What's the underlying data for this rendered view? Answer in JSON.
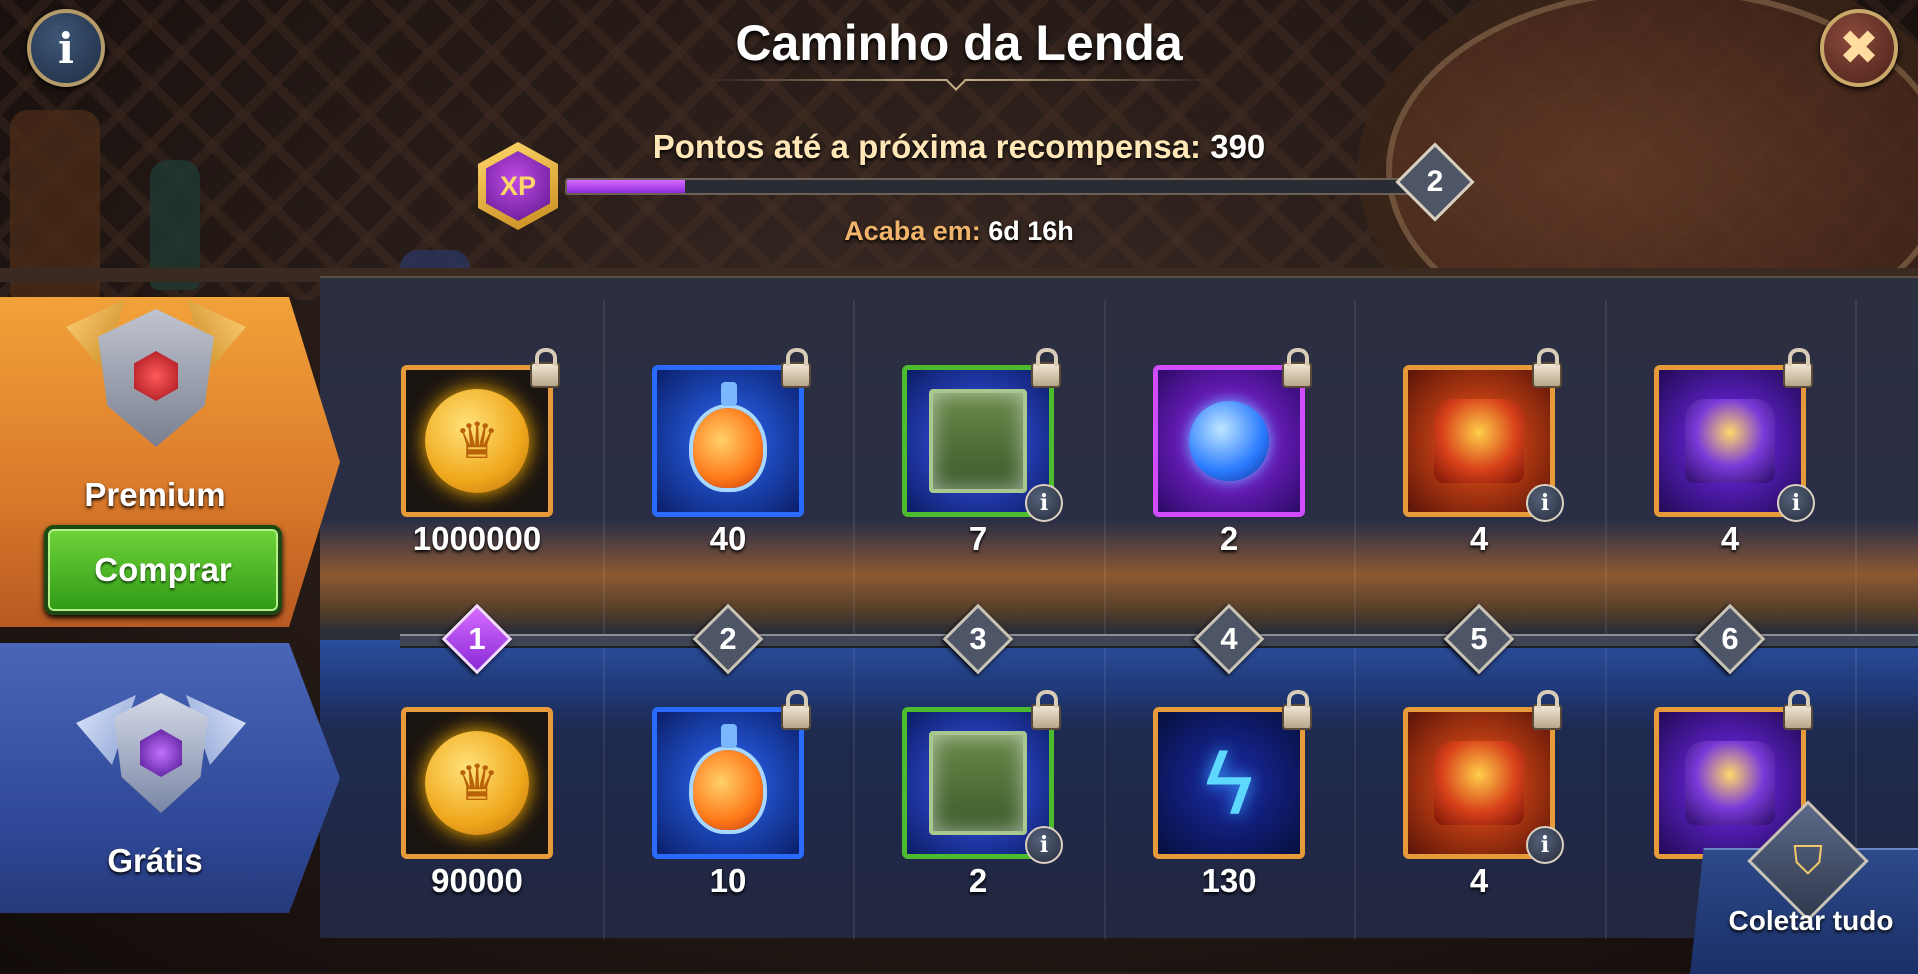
{
  "header": {
    "title": "Caminho da Lenda",
    "info_icon": "info-icon",
    "close_icon": "close-icon"
  },
  "progress": {
    "label": "Pontos até a próxima recompensa:",
    "points": "390",
    "fill_fraction": 0.14,
    "next_level": "2",
    "xp_badge_text": "XP",
    "ends_label": "Acaba em:",
    "ends_value": "6d 16h"
  },
  "tiers": {
    "premium": {
      "label": "Premium",
      "buy_label": "Comprar"
    },
    "free": {
      "label": "Grátis"
    }
  },
  "levels": [
    "1",
    "2",
    "3",
    "4",
    "5",
    "6"
  ],
  "active_level": "1",
  "premium_rewards": [
    {
      "amount": "1000000",
      "icon": "gold-coin-icon",
      "locked": true,
      "info": false
    },
    {
      "amount": "40",
      "icon": "potion-icon",
      "locked": true,
      "info": false
    },
    {
      "amount": "7",
      "icon": "chest-icon",
      "locked": true,
      "info": true
    },
    {
      "amount": "2",
      "icon": "orb-icon",
      "locked": true,
      "info": false
    },
    {
      "amount": "4",
      "icon": "red-relic-icon",
      "locked": true,
      "info": true
    },
    {
      "amount": "4",
      "icon": "purple-relic-icon",
      "locked": true,
      "info": true
    }
  ],
  "free_rewards": [
    {
      "amount": "90000",
      "icon": "gold-coin-icon",
      "locked": false,
      "info": false
    },
    {
      "amount": "10",
      "icon": "potion-icon",
      "locked": true,
      "info": false
    },
    {
      "amount": "2",
      "icon": "chest-icon",
      "locked": true,
      "info": true
    },
    {
      "amount": "130",
      "icon": "lightning-icon",
      "locked": true,
      "info": false
    },
    {
      "amount": "4",
      "icon": "red-relic-icon",
      "locked": true,
      "info": true
    },
    {
      "amount": "",
      "icon": "purple-relic-icon",
      "locked": true,
      "info": false
    }
  ],
  "collect_all": {
    "label": "Coletar tudo",
    "icon": "collect-all-icon"
  },
  "colors": {
    "accent_purple": "#b04aff",
    "premium_orange": "#e8892f",
    "free_blue": "#3a54a8",
    "buy_green": "#4cb52a"
  }
}
